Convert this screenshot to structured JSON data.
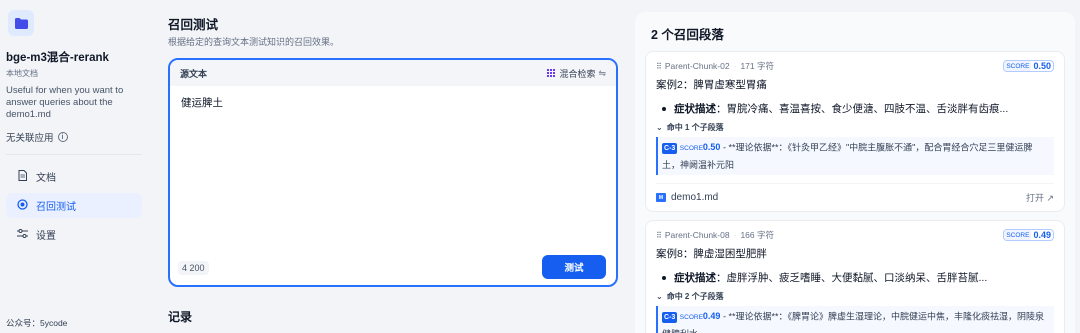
{
  "sidebar": {
    "dataset_name": "bge-m3混合-rerank",
    "dataset_type": "本地文档",
    "description": "Useful for when you want to answer queries about the demo1.md",
    "linked_apps": "无关联应用",
    "nav": [
      {
        "label": "文档",
        "icon": "document-icon"
      },
      {
        "label": "召回测试",
        "icon": "target-icon"
      },
      {
        "label": "设置",
        "icon": "settings-icon"
      }
    ],
    "footer": "公众号：5ycode"
  },
  "main": {
    "title": "召回测试",
    "subtitle": "根据给定的查询文本测试知识的召回效果。",
    "source_label": "源文本",
    "mode_label": "混合检索",
    "query": "健运脾土",
    "counter": "4 200",
    "test_button": "测试",
    "records_title": "记录"
  },
  "results": {
    "title": "2 个召回段落",
    "score_label": "SCORE",
    "open_label": "打开",
    "cards": [
      {
        "chunk": "Parent-Chunk-02",
        "chars": "171 字符",
        "score": "0.50",
        "title": "案例2：脾胃虚寒型胃痛",
        "bullet_label": "症状描述",
        "bullet_text": "：胃脘冷痛、喜温喜按、食少便溏、四肢不温、舌淡胖有齿痕...",
        "hits": "命中 1 个子段落",
        "child_badge": "C-3",
        "child_score": "0.50",
        "child_text": " - **理论依据**：《针灸甲乙经》\"中脘主腹胀不通\"，配合胃经合穴足三里健运脾土，神阙温补元阳",
        "file": "demo1.md"
      },
      {
        "chunk": "Parent-Chunk-08",
        "chars": "166 字符",
        "score": "0.49",
        "title": "案例8：脾虚湿困型肥胖",
        "bullet_label": "症状描述",
        "bullet_text": "：虚胖浮肿、疲乏嗜睡、大便黏腻、口淡纳呆、舌胖苔腻...",
        "hits": "命中 2 个子段落",
        "child_badge": "C-3",
        "child_score": "0.49",
        "child_text": " - **理论依据**：《脾胃论》脾虚生湿理论，中脘健运中焦，丰隆化痰祛湿，阴陵泉健脾利水"
      }
    ]
  }
}
